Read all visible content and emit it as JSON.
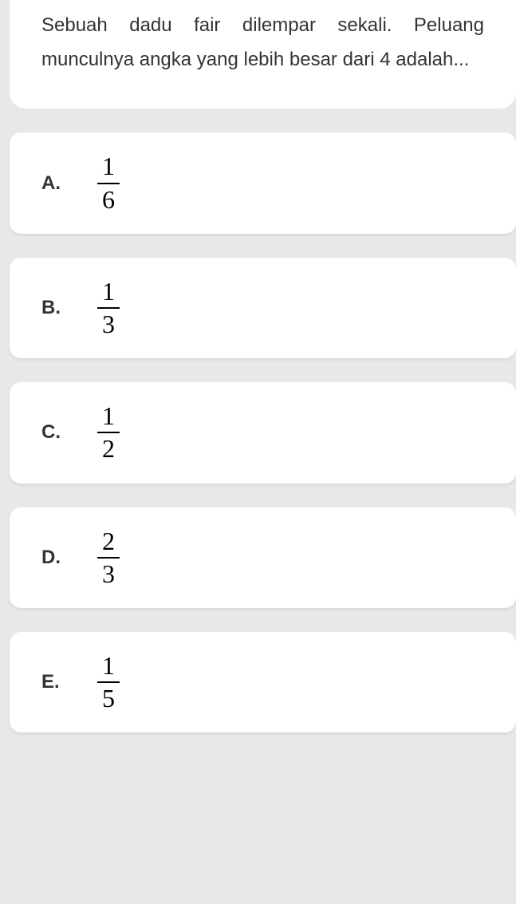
{
  "question": {
    "text": "Sebuah dadu fair dilempar sekali. Peluang munculnya angka yang lebih besar dari 4 adalah..."
  },
  "options": [
    {
      "label": "A.",
      "numerator": "1",
      "denominator": "6"
    },
    {
      "label": "B.",
      "numerator": "1",
      "denominator": "3"
    },
    {
      "label": "C.",
      "numerator": "1",
      "denominator": "2"
    },
    {
      "label": "D.",
      "numerator": "2",
      "denominator": "3"
    },
    {
      "label": "E.",
      "numerator": "1",
      "denominator": "5"
    }
  ]
}
